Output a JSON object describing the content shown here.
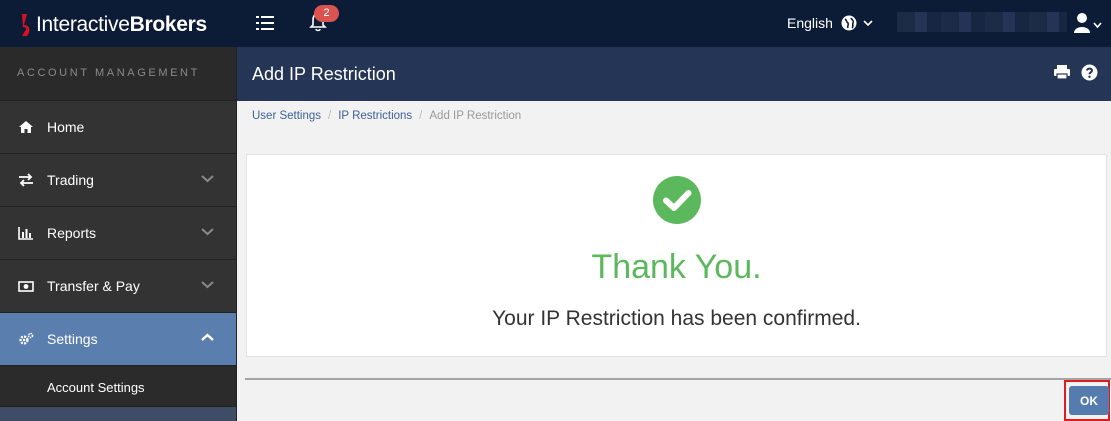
{
  "brand": {
    "name_light": "Interactive",
    "name_bold": "Brokers"
  },
  "notifications": {
    "count": "2"
  },
  "language": {
    "label": "English"
  },
  "sidebar": {
    "header": "ACCOUNT MANAGEMENT",
    "items": [
      {
        "label": "Home",
        "icon": "home-icon"
      },
      {
        "label": "Trading",
        "icon": "arrows-icon"
      },
      {
        "label": "Reports",
        "icon": "bar-chart-icon"
      },
      {
        "label": "Transfer & Pay",
        "icon": "money-icon"
      },
      {
        "label": "Settings",
        "icon": "gears-icon"
      }
    ],
    "sub_items": [
      {
        "label": "Account Settings"
      }
    ]
  },
  "page": {
    "title": "Add IP Restriction"
  },
  "breadcrumb": [
    "User Settings",
    "IP Restrictions",
    "Add IP Restriction"
  ],
  "card": {
    "heading": "Thank You.",
    "message": "Your IP Restriction has been confirmed."
  },
  "footer": {
    "ok_label": "OK"
  },
  "colors": {
    "nav_bg": "#0d1c36",
    "header_bg": "#243556",
    "accent": "#557cae",
    "success": "#5cb85c",
    "badge": "#d9534f",
    "highlight": "#e01b1b"
  }
}
